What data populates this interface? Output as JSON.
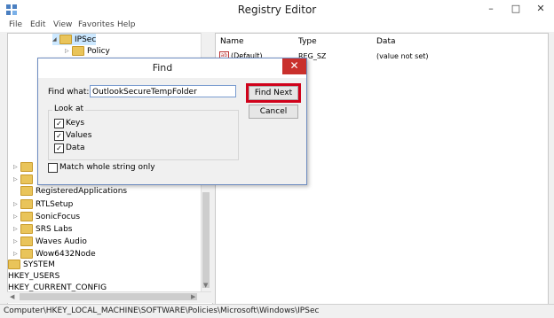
{
  "window": {
    "title": "Registry Editor",
    "min": "–",
    "max": "□",
    "close": "✕"
  },
  "menu": [
    "File",
    "Edit",
    "View",
    "Favorites",
    "Help"
  ],
  "tree": {
    "top": [
      {
        "label": "IPSec",
        "exp": "◢"
      },
      {
        "label": "Policy",
        "exp": "▷"
      }
    ],
    "items": [
      "RegisteredApplications",
      "RTLSetup",
      "SonicFocus",
      "SRS Labs",
      "Waves Audio",
      "Wow6432Node",
      "SYSTEM",
      "HKEY_USERS",
      "HKEY_CURRENT_CONFIG"
    ]
  },
  "list": {
    "headers": {
      "name": "Name",
      "type": "Type",
      "data": "Data"
    },
    "rows": [
      {
        "name": "(Default)",
        "type": "REG_SZ",
        "data": "(value not set)",
        "icon": "ab"
      }
    ]
  },
  "status": "Computer\\HKEY_LOCAL_MACHINE\\SOFTWARE\\Policies\\Microsoft\\Windows\\IPSec",
  "find": {
    "title": "Find",
    "close": "✕",
    "find_what_label": "Find what:",
    "find_value": "OutlookSecureTempFolder",
    "find_next": "Find Next",
    "cancel": "Cancel",
    "look_at": "Look at",
    "keys": "Keys",
    "values": "Values",
    "data": "Data",
    "match_whole": "Match whole string only",
    "check": "✓"
  }
}
